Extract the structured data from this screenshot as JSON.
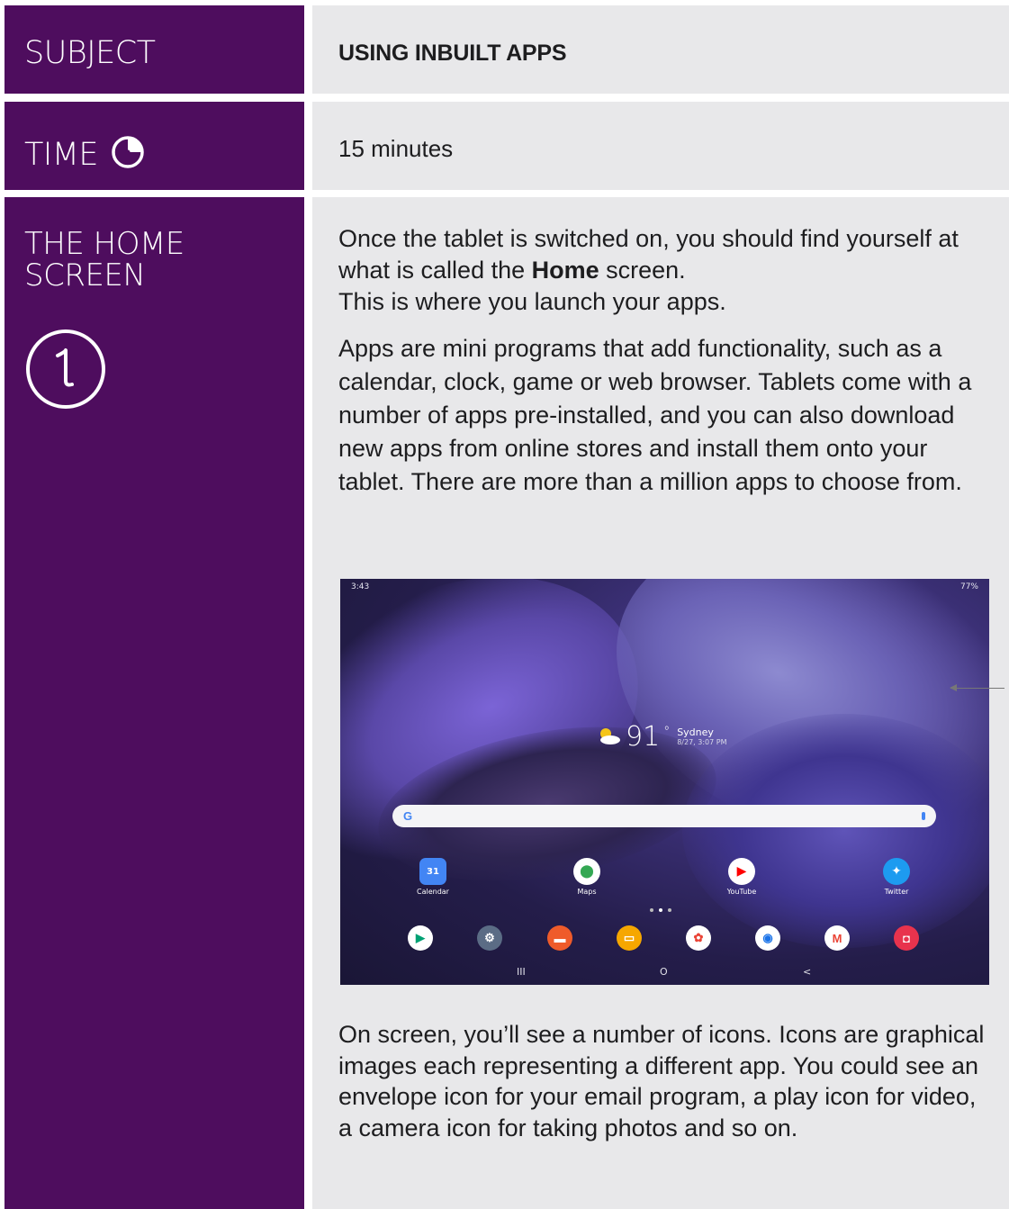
{
  "rows": {
    "subject": {
      "label": "SUBJECT",
      "value": "USING INBUILT APPS"
    },
    "time": {
      "label": "TIME",
      "value": "15 minutes"
    },
    "home_screen": {
      "label_line1": "THE HOME",
      "label_line2": "SCREEN",
      "step_number": "1",
      "para1_a": "Once the tablet is switched on, you should find yourself at what is called the ",
      "para1_bold": "Home",
      "para1_b": " screen.",
      "para1_c": "This is where you launch your apps.",
      "para2": "Apps are mini programs that add functionality, such as a calendar, clock, game or web browser. Tablets come with a number of apps pre-installed, and you can also download new apps from online stores and install them onto your tablet. There are more than a million apps to choose from.",
      "para3": "On screen, you’ll see a number of icons. Icons are graphical images each representing a different app. You could see an envelope icon for your email program, a play icon for video, a camera icon for taking photos and so on."
    }
  },
  "tablet": {
    "time": "3:43",
    "battery": "77%",
    "temperature": "91",
    "temp_unit": "°",
    "city": "Sydney",
    "updated": "8/27, 3:07 PM",
    "search_logo": "G",
    "apps": [
      {
        "label": "Calendar",
        "icon": "calendar-icon",
        "glyph": "31",
        "color": "#4285f4"
      },
      {
        "label": "Maps",
        "icon": "maps-icon",
        "glyph": "⬤",
        "color": "#34a853"
      },
      {
        "label": "YouTube",
        "icon": "youtube-icon",
        "glyph": "▶",
        "color": "#ff0000"
      },
      {
        "label": "Twitter",
        "icon": "twitter-icon",
        "glyph": "✦",
        "color": "#1d9bf0"
      }
    ],
    "dock": [
      {
        "icon": "play-store-icon",
        "glyph": "▶",
        "color": "#ffffff",
        "fg": "#00a173"
      },
      {
        "icon": "settings-icon",
        "glyph": "⚙",
        "color": "#5b6c85",
        "fg": "#ffffff"
      },
      {
        "icon": "notes-icon",
        "glyph": "▬",
        "color": "#ef5b2a",
        "fg": "#ffffff"
      },
      {
        "icon": "files-icon",
        "glyph": "▭",
        "color": "#f6a700",
        "fg": "#ffffff"
      },
      {
        "icon": "photos-icon",
        "glyph": "✿",
        "color": "#ffffff",
        "fg": "#ea4335"
      },
      {
        "icon": "chrome-icon",
        "glyph": "◉",
        "color": "#ffffff",
        "fg": "#1a73e8"
      },
      {
        "icon": "gmail-icon",
        "glyph": "M",
        "color": "#ffffff",
        "fg": "#ea4335"
      },
      {
        "icon": "camera-icon",
        "glyph": "◘",
        "color": "#e8334d",
        "fg": "#ffffff"
      }
    ],
    "nav": {
      "recent": "III",
      "home": "O",
      "back": "<"
    }
  },
  "colors": {
    "left_panel": "#4e0d5e",
    "right_panel": "#e8e8ea"
  }
}
